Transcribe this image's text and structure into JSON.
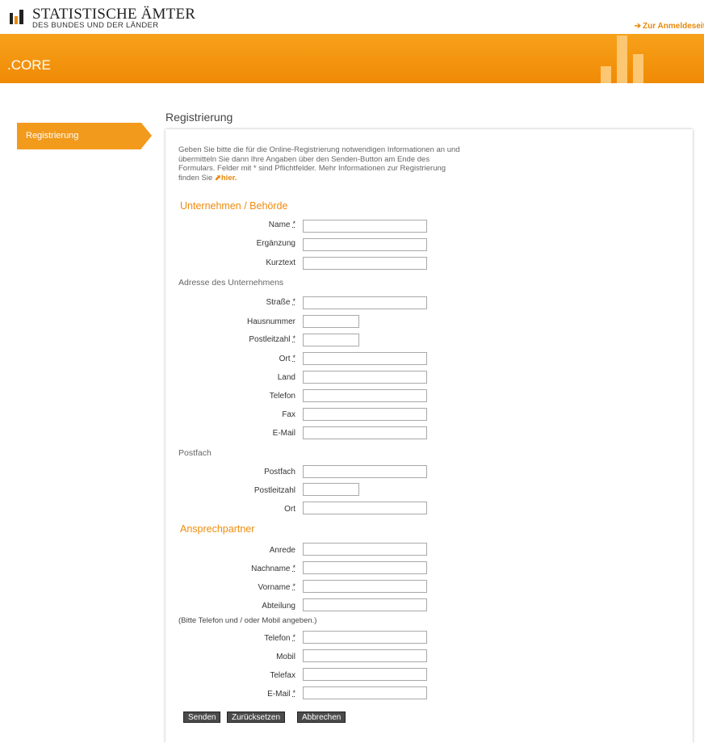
{
  "header": {
    "logo_title": "STATISTISCHE ÄMTER",
    "logo_subtitle": "DES BUNDES UND DER LÄNDER",
    "login_link": "Zur Anmeldeseit"
  },
  "banner": {
    "title": ".CORE"
  },
  "sidebar": {
    "items": [
      {
        "label": "Registrierung"
      }
    ]
  },
  "page_title": "Registrierung",
  "intro": {
    "lines": [
      "Geben Sie bitte die für die Online-Registrierung notwendigen Informationen an und",
      "übermitteln Sie dann Ihre Angaben über den Senden-Button am Ende des",
      "Formulars. Felder mit * sind Pflichtfelder. Mehr Informationen zur Registrierung"
    ],
    "last_prefix": "finden Sie ",
    "link_label": "hier."
  },
  "sections": {
    "company": "Unternehmen / Behörde",
    "address": "Adresse des Unternehmens",
    "postbox": "Postfach",
    "contact": "Ansprechpartner",
    "contact_note": "(Bitte Telefon und / oder Mobil angeben.)"
  },
  "required_mark": "*",
  "fields": {
    "name": {
      "label": "Name",
      "value": ""
    },
    "ergaenzung": {
      "label": "Ergänzung",
      "value": ""
    },
    "kurztext": {
      "label": "Kurztext",
      "value": ""
    },
    "strasse": {
      "label": "Straße",
      "value": ""
    },
    "hausnummer": {
      "label": "Hausnummer",
      "value": ""
    },
    "plz": {
      "label": "Postleitzahl",
      "value": ""
    },
    "ort": {
      "label": "Ort",
      "value": ""
    },
    "land": {
      "label": "Land",
      "value": ""
    },
    "telefon": {
      "label": "Telefon",
      "value": ""
    },
    "fax": {
      "label": "Fax",
      "value": ""
    },
    "email": {
      "label": "E-Mail",
      "value": ""
    },
    "postfach": {
      "label": "Postfach",
      "value": ""
    },
    "postfach_plz": {
      "label": "Postleitzahl",
      "value": ""
    },
    "postfach_ort": {
      "label": "Ort",
      "value": ""
    },
    "anrede": {
      "label": "Anrede",
      "value": ""
    },
    "nachname": {
      "label": "Nachname",
      "value": ""
    },
    "vorname": {
      "label": "Vorname",
      "value": ""
    },
    "abteilung": {
      "label": "Abteilung",
      "value": ""
    },
    "cp_telefon": {
      "label": "Telefon",
      "value": ""
    },
    "mobil": {
      "label": "Mobil",
      "value": ""
    },
    "telefax": {
      "label": "Telefax",
      "value": ""
    },
    "cp_email": {
      "label": "E-Mail",
      "value": ""
    }
  },
  "buttons": {
    "send": "Senden",
    "reset": "Zurücksetzen",
    "cancel": "Abbrechen"
  },
  "colors": {
    "accent": "#f29a1c",
    "link": "#e8890b",
    "banner": "#f7a11a"
  }
}
